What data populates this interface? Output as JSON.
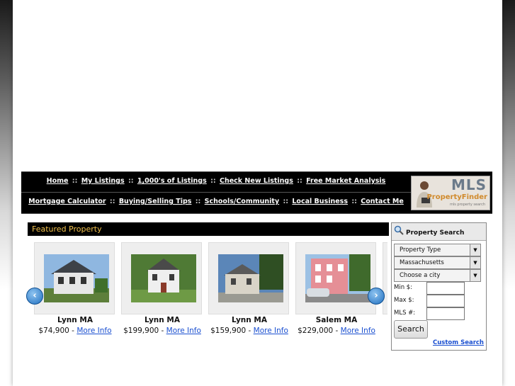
{
  "nav": {
    "row1": [
      "Home",
      "My Listings",
      "1,000's of Listings",
      "Check New Listings",
      "Free Market Analysis"
    ],
    "row2": [
      "Mortgage Calculator",
      "Buying/Selling Tips",
      "Schools/Community",
      "Local Business",
      "Contact Me"
    ],
    "separator": "::"
  },
  "logo": {
    "mls": "MLS",
    "brand": "PropertyFinder",
    "tagline": "mls property search"
  },
  "featured": {
    "header": "Featured Property",
    "items": [
      {
        "city": "Lynn MA",
        "price": "$74,900",
        "dash": " - ",
        "link": "More Info"
      },
      {
        "city": "Lynn MA",
        "price": "$199,900",
        "dash": " - ",
        "link": "More Info"
      },
      {
        "city": "Lynn MA",
        "price": "$159,900",
        "dash": " - ",
        "link": "More Info"
      },
      {
        "city": "Salem MA",
        "price": "$229,000",
        "dash": " - ",
        "link": "More Info"
      }
    ],
    "prev_icon": "chevron-left-icon",
    "next_icon": "chevron-right-icon"
  },
  "search": {
    "title": "Property Search",
    "property_type": "Property Type",
    "state": "Massachusetts",
    "city": "Choose a city",
    "min_label": "Min $:",
    "max_label": "Max $:",
    "mls_label": "MLS #:",
    "min_value": "",
    "max_value": "",
    "mls_value": "",
    "button": "Search",
    "custom_link": "Custom Search"
  },
  "colors": {
    "featured_header_text": "#f2c14e",
    "link": "#1a4fd0",
    "navbar_bg": "#000000"
  }
}
